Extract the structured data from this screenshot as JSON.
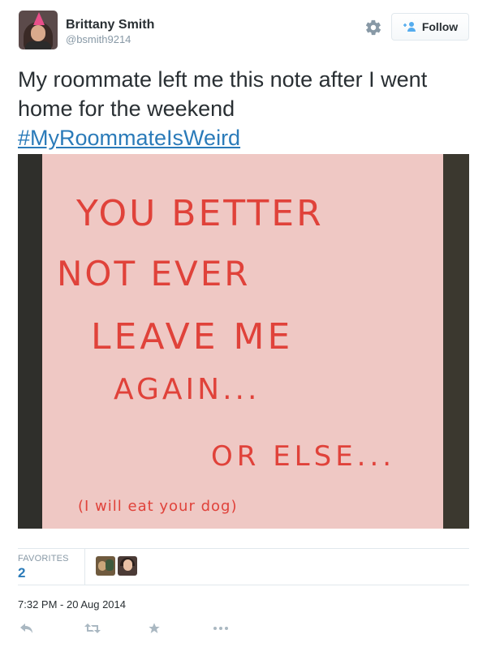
{
  "user": {
    "name": "Brittany Smith",
    "handle": "@bsmith9214"
  },
  "follow_button": {
    "label": "Follow",
    "icon": "add-person-icon"
  },
  "settings_icon": "gear-icon",
  "tweet": {
    "text": "My roommate left me this note after I went home for the weekend",
    "hashtag": "#MyRoommateIsWeird"
  },
  "photo": {
    "note_lines": [
      "YOU BETTER",
      "NOT EVER",
      "LEAVE ME",
      "AGAIN...",
      "OR ELSE...",
      "(I will eat your dog)"
    ],
    "note_ink_color": "#e0423a",
    "note_paper_color": "#efc8c4"
  },
  "stats": {
    "favorites_label": "FAVORITES",
    "favorites_count": "2"
  },
  "timestamp": "7:32 PM - 20 Aug 2014",
  "actions": [
    {
      "name": "reply",
      "icon": "reply-icon"
    },
    {
      "name": "retweet",
      "icon": "retweet-icon"
    },
    {
      "name": "favorite",
      "icon": "star-icon"
    },
    {
      "name": "more",
      "icon": "more-icon"
    }
  ],
  "colors": {
    "link": "#2b7bb9",
    "muted": "#8899a6",
    "text": "#292f33",
    "border": "#e1e8ed"
  }
}
